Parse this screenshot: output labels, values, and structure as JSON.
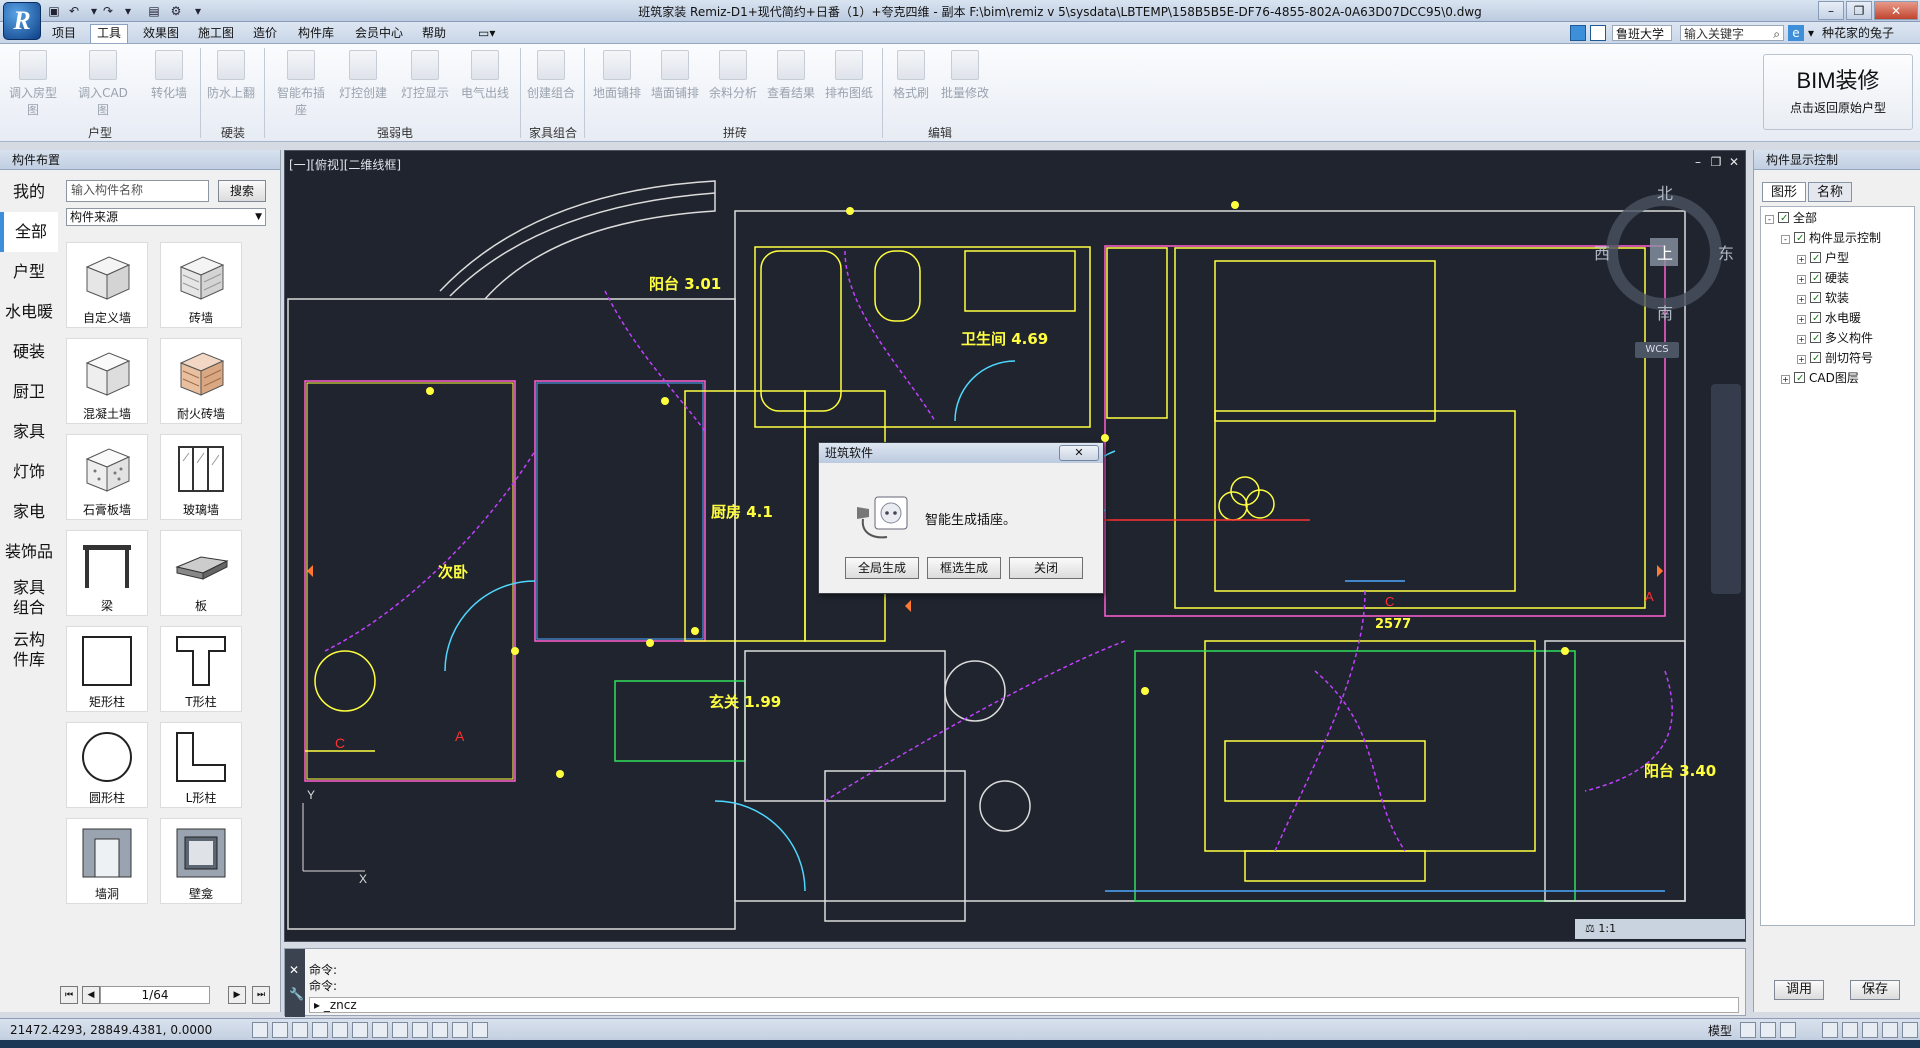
{
  "window": {
    "title": "班筑家装 Remiz-D1+现代简约+日番（1）+夸克四维 - 副本     F:\\bim\\remiz v 5\\sysdata\\LBTEMP\\158B5B5E-DF76-4855-802A-0A63D07DCC95\\0.dwg",
    "logo": "R"
  },
  "menubar": {
    "items": [
      "项目",
      "工具",
      "效果图",
      "施工图",
      "造价",
      "构件库",
      "会员中心",
      "帮助"
    ],
    "active": "工具",
    "org": "鲁班大学",
    "search_placeholder": "输入关键字",
    "user": "种花家的兔子"
  },
  "ribbon": {
    "buttons": [
      "调入房型图",
      "调入CAD图",
      "转化墙",
      "防水上翻",
      "智能布插座",
      "灯控创建",
      "灯控显示",
      "电气出线",
      "创建组合",
      "地面铺排",
      "墙面铺排",
      "余料分析",
      "查看结果",
      "排布图纸",
      "格式刷",
      "批量修改"
    ],
    "groups": [
      "户型",
      "硬装",
      "强弱电",
      "家具组合",
      "拼砖",
      "编辑"
    ],
    "bim_title": "BIM装修",
    "bim_sub": "点击返回原始户型"
  },
  "leftpanel": {
    "title": "构件布置",
    "categories": [
      "我的",
      "全部",
      "户型",
      "水电暖",
      "硬装",
      "厨卫",
      "家具",
      "灯饰",
      "家电",
      "装饰品",
      "家具组合",
      "云构件库"
    ],
    "selected_category": "全部",
    "search_placeholder": "输入构件名称",
    "search_btn": "搜索",
    "source": "构件来源",
    "components": [
      "自定义墙",
      "砖墙",
      "混凝土墙",
      "耐火砖墙",
      "石膏板墙",
      "玻璃墙",
      "梁",
      "板",
      "矩形柱",
      "T形柱",
      "圆形柱",
      "L形柱",
      "墙洞",
      "壁龛"
    ],
    "page": "1/64"
  },
  "canvas": {
    "view_label": "[一][俯视][二维线框]",
    "rooms": [
      "阳台 3.01",
      "卫生间 4.69",
      "厨房 4.1",
      "次卧",
      "玄关 1.99",
      "阳台 3.40"
    ],
    "dimension": "2577",
    "compass": {
      "n": "北",
      "s": "南",
      "w": "西",
      "e": "东",
      "center": "上",
      "wcs": "WCS"
    },
    "scale": "1:1"
  },
  "dialog": {
    "title": "班筑软件",
    "message": "智能生成插座。",
    "buttons": [
      "全局生成",
      "框选生成",
      "关闭"
    ]
  },
  "rightpanel": {
    "title": "构件显示控制",
    "tabs": [
      "图形",
      "名称"
    ],
    "tree": [
      "全部",
      "构件显示控制",
      "户型",
      "硬装",
      "软装",
      "水电暖",
      "多义构件",
      "剖切符号",
      "CAD图层"
    ],
    "btn_apply": "调用",
    "btn_save": "保存"
  },
  "command": {
    "line1": "命令:",
    "line2": "命令:",
    "input": "_zncz"
  },
  "status": {
    "coords": "21472.4293, 28849.4381, 0.0000",
    "model": "模型"
  },
  "colors": {
    "canvas_bg": "#20242e",
    "room_text": "#ffff40",
    "accent": "#3c8fd8"
  }
}
